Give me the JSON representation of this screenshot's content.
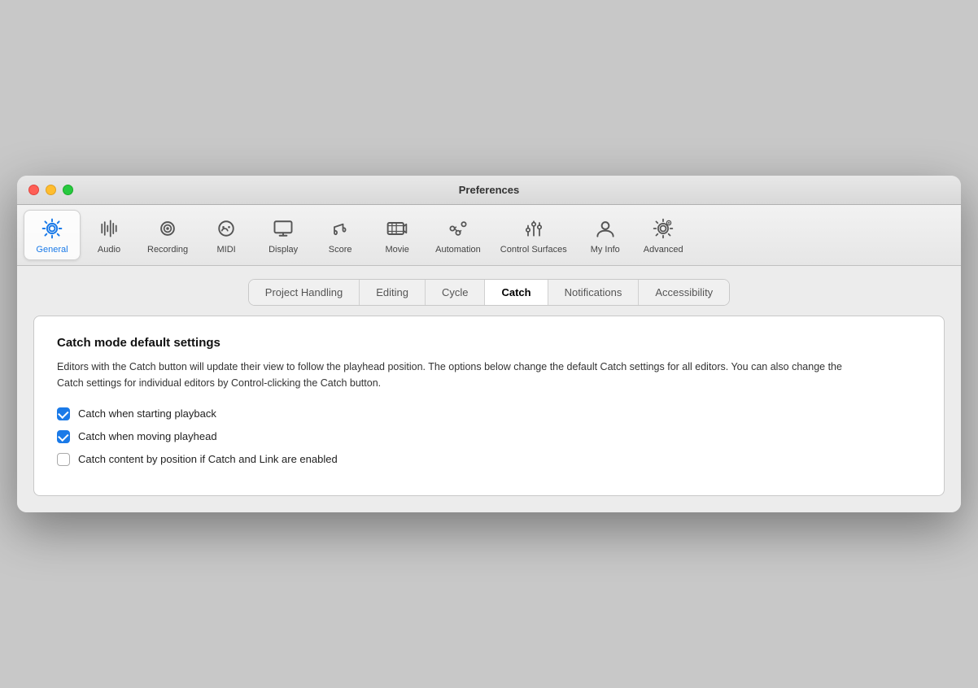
{
  "window": {
    "title": "Preferences"
  },
  "toolbar": {
    "items": [
      {
        "id": "general",
        "label": "General",
        "active": true,
        "icon": "gear"
      },
      {
        "id": "audio",
        "label": "Audio",
        "active": false,
        "icon": "audio"
      },
      {
        "id": "recording",
        "label": "Recording",
        "active": false,
        "icon": "recording"
      },
      {
        "id": "midi",
        "label": "MIDI",
        "active": false,
        "icon": "midi"
      },
      {
        "id": "display",
        "label": "Display",
        "active": false,
        "icon": "display"
      },
      {
        "id": "score",
        "label": "Score",
        "active": false,
        "icon": "score"
      },
      {
        "id": "movie",
        "label": "Movie",
        "active": false,
        "icon": "movie"
      },
      {
        "id": "automation",
        "label": "Automation",
        "active": false,
        "icon": "automation"
      },
      {
        "id": "control-surfaces",
        "label": "Control Surfaces",
        "active": false,
        "icon": "control-surfaces"
      },
      {
        "id": "my-info",
        "label": "My Info",
        "active": false,
        "icon": "my-info"
      },
      {
        "id": "advanced",
        "label": "Advanced",
        "active": false,
        "icon": "advanced"
      }
    ]
  },
  "subtabs": {
    "items": [
      {
        "id": "project-handling",
        "label": "Project Handling",
        "active": false
      },
      {
        "id": "editing",
        "label": "Editing",
        "active": false
      },
      {
        "id": "cycle",
        "label": "Cycle",
        "active": false
      },
      {
        "id": "catch",
        "label": "Catch",
        "active": true
      },
      {
        "id": "notifications",
        "label": "Notifications",
        "active": false
      },
      {
        "id": "accessibility",
        "label": "Accessibility",
        "active": false
      }
    ]
  },
  "panel": {
    "title": "Catch mode default settings",
    "description": "Editors with the Catch button will update their view to follow the playhead position. The options below change the default Catch settings for all editors. You can also change the Catch settings for individual editors by Control-clicking the Catch button.",
    "checkboxes": [
      {
        "id": "catch-playback",
        "label": "Catch when starting playback",
        "checked": true
      },
      {
        "id": "catch-playhead",
        "label": "Catch when moving playhead",
        "checked": true
      },
      {
        "id": "catch-position",
        "label": "Catch content by position if Catch and Link are enabled",
        "checked": false
      }
    ]
  }
}
